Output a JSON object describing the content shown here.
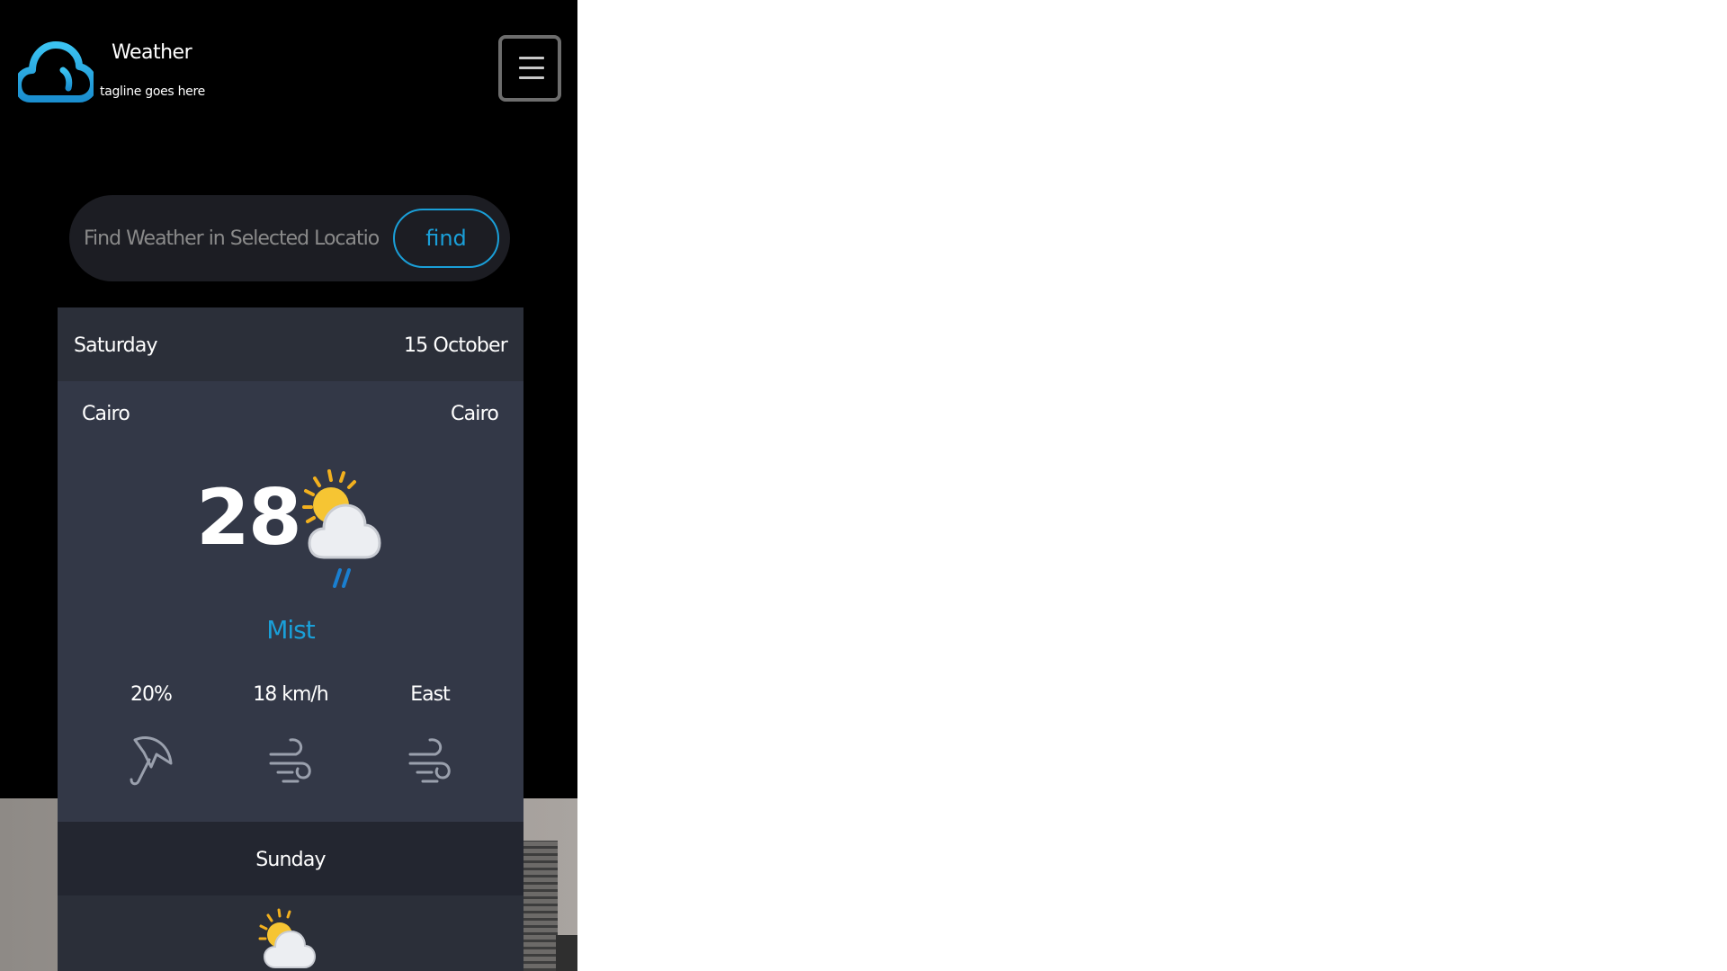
{
  "header": {
    "brand_title": "Weather",
    "tagline": "tagline goes here",
    "logo_icon": "cloud-icon",
    "menu_icon": "hamburger-menu-icon"
  },
  "search": {
    "placeholder": "Find Weather in Selected Location",
    "button_label": "find"
  },
  "today": {
    "day": "Saturday",
    "date": "15 October",
    "location_left": "Cairo",
    "location_right": "Cairo",
    "temperature": "28",
    "condition_icon": "sun-cloud-rain-icon",
    "condition": "Mist",
    "stats": [
      {
        "value": "20%",
        "icon": "umbrella-icon"
      },
      {
        "value": "18 km/h",
        "icon": "wind-icon"
      },
      {
        "value": "East",
        "icon": "wind-direction-icon"
      }
    ]
  },
  "next_day": {
    "day": "Sunday",
    "condition_icon": "sun-cloud-icon"
  },
  "colors": {
    "accent": "#1a9fd8",
    "page_bg": "#000000",
    "card_header_bg": "#2b2f39",
    "card_body_bg": "#333847",
    "search_bg": "#1c1d23"
  }
}
